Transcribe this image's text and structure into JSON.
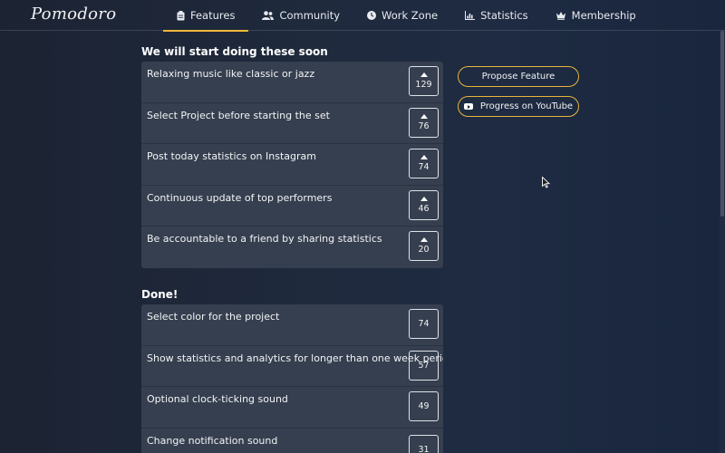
{
  "app": {
    "logo": "Pomodoro"
  },
  "nav": [
    {
      "label": "Features",
      "icon": "clipboard-icon",
      "active": true
    },
    {
      "label": "Community",
      "icon": "users-icon",
      "active": false
    },
    {
      "label": "Work Zone",
      "icon": "clock-icon",
      "active": false
    },
    {
      "label": "Statistics",
      "icon": "bar-chart-icon",
      "active": false
    },
    {
      "label": "Membership",
      "icon": "crown-icon",
      "active": false
    }
  ],
  "upcoming": {
    "title": "We will start doing these soon",
    "items": [
      {
        "text": "Relaxing music like classic or jazz",
        "votes": "129"
      },
      {
        "text": "Select Project before starting the set",
        "votes": "76"
      },
      {
        "text": "Post today statistics on Instagram",
        "votes": "74"
      },
      {
        "text": "Continuous update of top performers",
        "votes": "46"
      },
      {
        "text": "Be accountable to a friend by sharing statistics",
        "votes": "20"
      }
    ]
  },
  "done": {
    "title": "Done!",
    "items": [
      {
        "text": "Select color for the project",
        "votes": "74"
      },
      {
        "text": "Show statistics and analytics for longer than one week period.",
        "votes": "57"
      },
      {
        "text": "Optional clock-ticking sound",
        "votes": "49"
      },
      {
        "text": "Change notification sound",
        "votes": "31"
      }
    ]
  },
  "side": {
    "propose_label": "Propose Feature",
    "youtube_label": "Progress on YouTube"
  },
  "colors": {
    "accent": "#f0b83a",
    "card": "#353f4f",
    "bg": "#1f2a3d"
  }
}
